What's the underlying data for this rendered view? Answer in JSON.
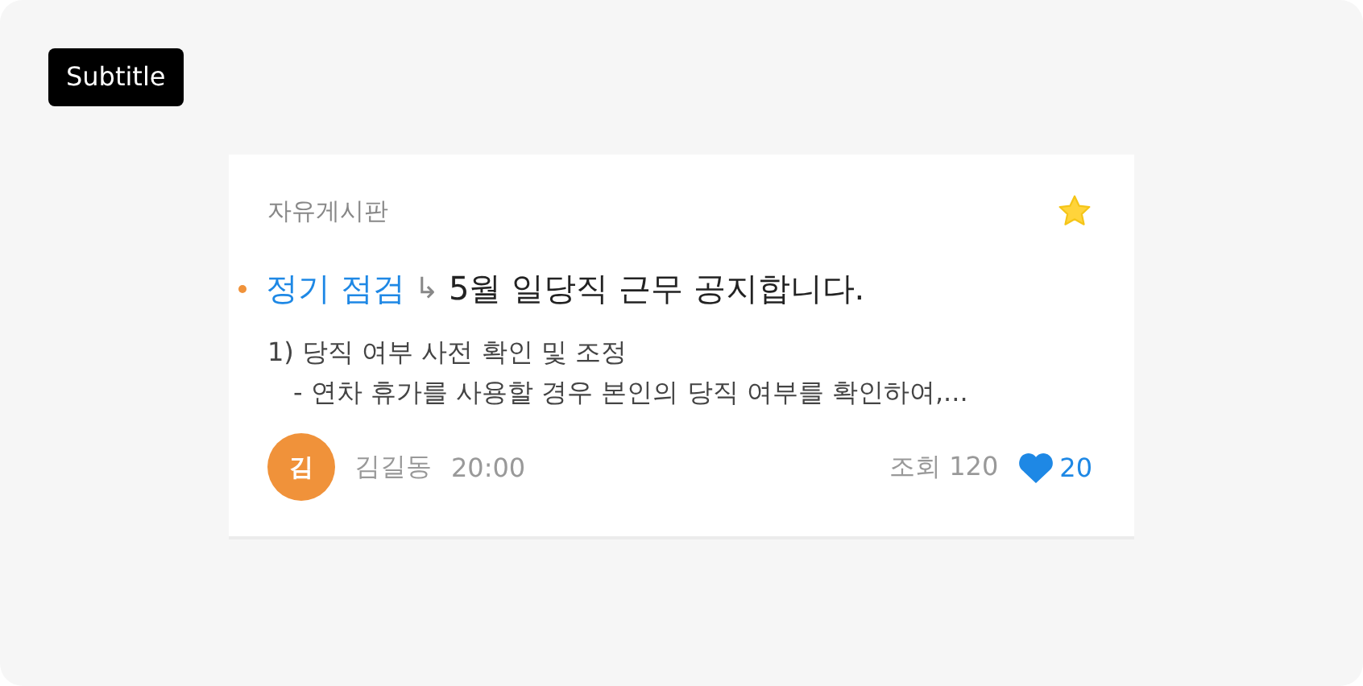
{
  "badge": "Subtitle",
  "post": {
    "board": "자유게시판",
    "favorite": true,
    "unread": true,
    "category": "정기 점검",
    "arrow": "↳",
    "title": "5월 일당직 근무 공지합니다.",
    "body": [
      "1) 당직 여부 사전 확인 및 조정",
      "- 연차 휴가를 사용할 경우 본인의 당직 여부를 확인하여,..."
    ],
    "avatar": "김",
    "author": "김길동",
    "time": "20:00",
    "views": "조회 120",
    "liked": true,
    "likes": "20"
  }
}
